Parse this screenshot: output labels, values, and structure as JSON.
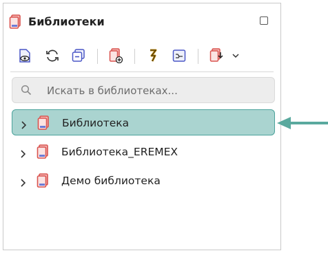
{
  "panel": {
    "title": "Библиотеки"
  },
  "toolbar": {
    "buttons": [
      {
        "name": "view-icon"
      },
      {
        "name": "refresh-icon"
      },
      {
        "name": "collapse-icon"
      },
      {
        "name": "add-library-icon"
      },
      {
        "name": "link-icon"
      },
      {
        "name": "schematic-icon"
      },
      {
        "name": "import-icon"
      },
      {
        "name": "dropdown-chevron-icon"
      }
    ]
  },
  "search": {
    "placeholder": "Искать в библиотеках..."
  },
  "tree": {
    "items": [
      {
        "label": "Библиотека",
        "selected": true
      },
      {
        "label": "Библиотека_EREMEX",
        "selected": false
      },
      {
        "label": "Демо библиотека",
        "selected": false
      }
    ]
  },
  "colors": {
    "selection_bg": "#aad4d0",
    "selection_border": "#4aa29b",
    "arrow": "#5aa99e",
    "library_icon": "#d9534f"
  }
}
